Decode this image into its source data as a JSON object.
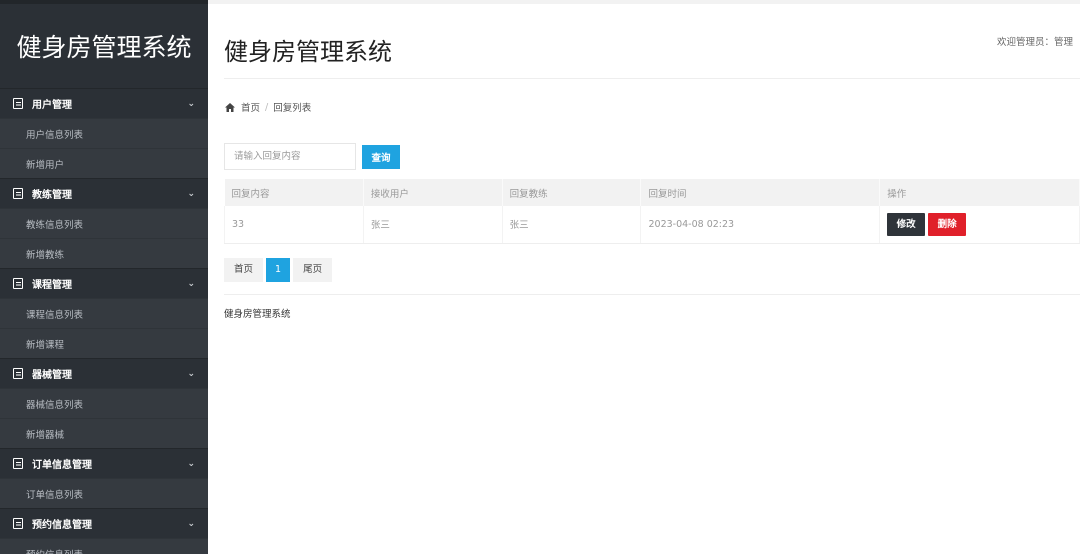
{
  "sidebar": {
    "brand": "健身房管理系统",
    "groups": [
      {
        "label": "用户管理",
        "items": [
          "用户信息列表",
          "新增用户"
        ]
      },
      {
        "label": "教练管理",
        "items": [
          "教练信息列表",
          "新增教练"
        ]
      },
      {
        "label": "课程管理",
        "items": [
          "课程信息列表",
          "新增课程"
        ]
      },
      {
        "label": "器械管理",
        "items": [
          "器械信息列表",
          "新增器械"
        ]
      },
      {
        "label": "订单信息管理",
        "items": [
          "订单信息列表"
        ]
      },
      {
        "label": "预约信息管理",
        "items": [
          "预约信息列表"
        ]
      }
    ]
  },
  "header": {
    "title": "健身房管理系统",
    "welcome": "欢迎管理员：管理"
  },
  "breadcrumb": {
    "home": "首页",
    "current": "回复列表"
  },
  "search": {
    "placeholder": "请输入回复内容",
    "button": "查询"
  },
  "table": {
    "headers": [
      "回复内容",
      "接收用户",
      "回复教练",
      "回复时间",
      "操作"
    ],
    "rows": [
      {
        "content": "33",
        "user": "张三",
        "coach": "张三",
        "time": "2023-04-08 02:23"
      }
    ],
    "edit_label": "修改",
    "delete_label": "删除"
  },
  "pager": {
    "first": "首页",
    "current": "1",
    "last": "尾页"
  },
  "footer": "健身房管理系统",
  "colors": {
    "sidebar_bg": "#2b3036",
    "primary": "#1fa3e0",
    "danger": "#e0202a",
    "dark_button": "#2f343a"
  },
  "icons": {
    "menu_group": "document-icon",
    "chevron": "chevron-down-icon",
    "breadcrumb_home": "home-icon"
  }
}
